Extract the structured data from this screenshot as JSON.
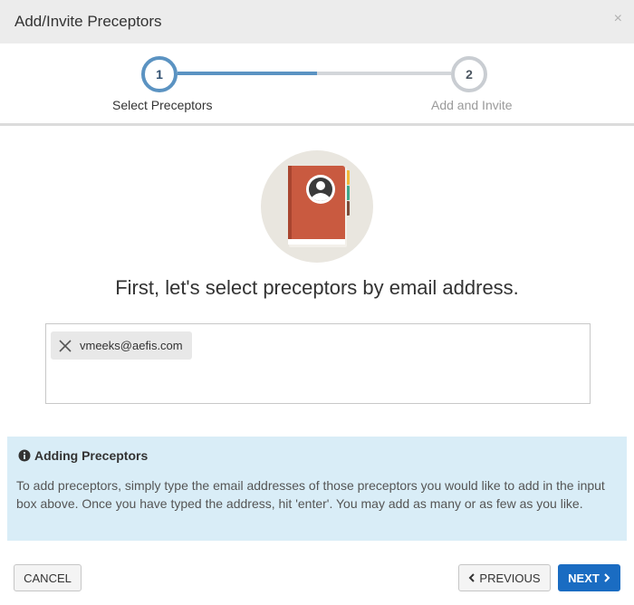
{
  "modal": {
    "title": "Add/Invite Preceptors",
    "close_icon": "×"
  },
  "stepper": {
    "steps": [
      {
        "number": "1",
        "label": "Select Preceptors",
        "state": "active"
      },
      {
        "number": "2",
        "label": "Add and Invite",
        "state": "inactive"
      }
    ],
    "colors": {
      "active": "#5b93c2",
      "inactive": "#d3d6da"
    }
  },
  "illustration": {
    "icon": "address-book-icon"
  },
  "headline": "First, let's select preceptors by email address.",
  "email_input": {
    "chips": [
      {
        "email": "vmeeks@aefis.com"
      }
    ],
    "value": ""
  },
  "info": {
    "icon": "info-circle-icon",
    "title": "Adding Preceptors",
    "body": "To add preceptors, simply type the email addresses of those preceptors you would like to add in the input box above. Once you have typed the address, hit 'enter'. You may add as many or as few as you like."
  },
  "footer": {
    "cancel_label": "CANCEL",
    "previous_label": "PREVIOUS",
    "next_label": "NEXT"
  },
  "colors": {
    "primary": "#1a6cc2",
    "info_bg": "#d9edf7",
    "header_bg": "#ececec"
  }
}
